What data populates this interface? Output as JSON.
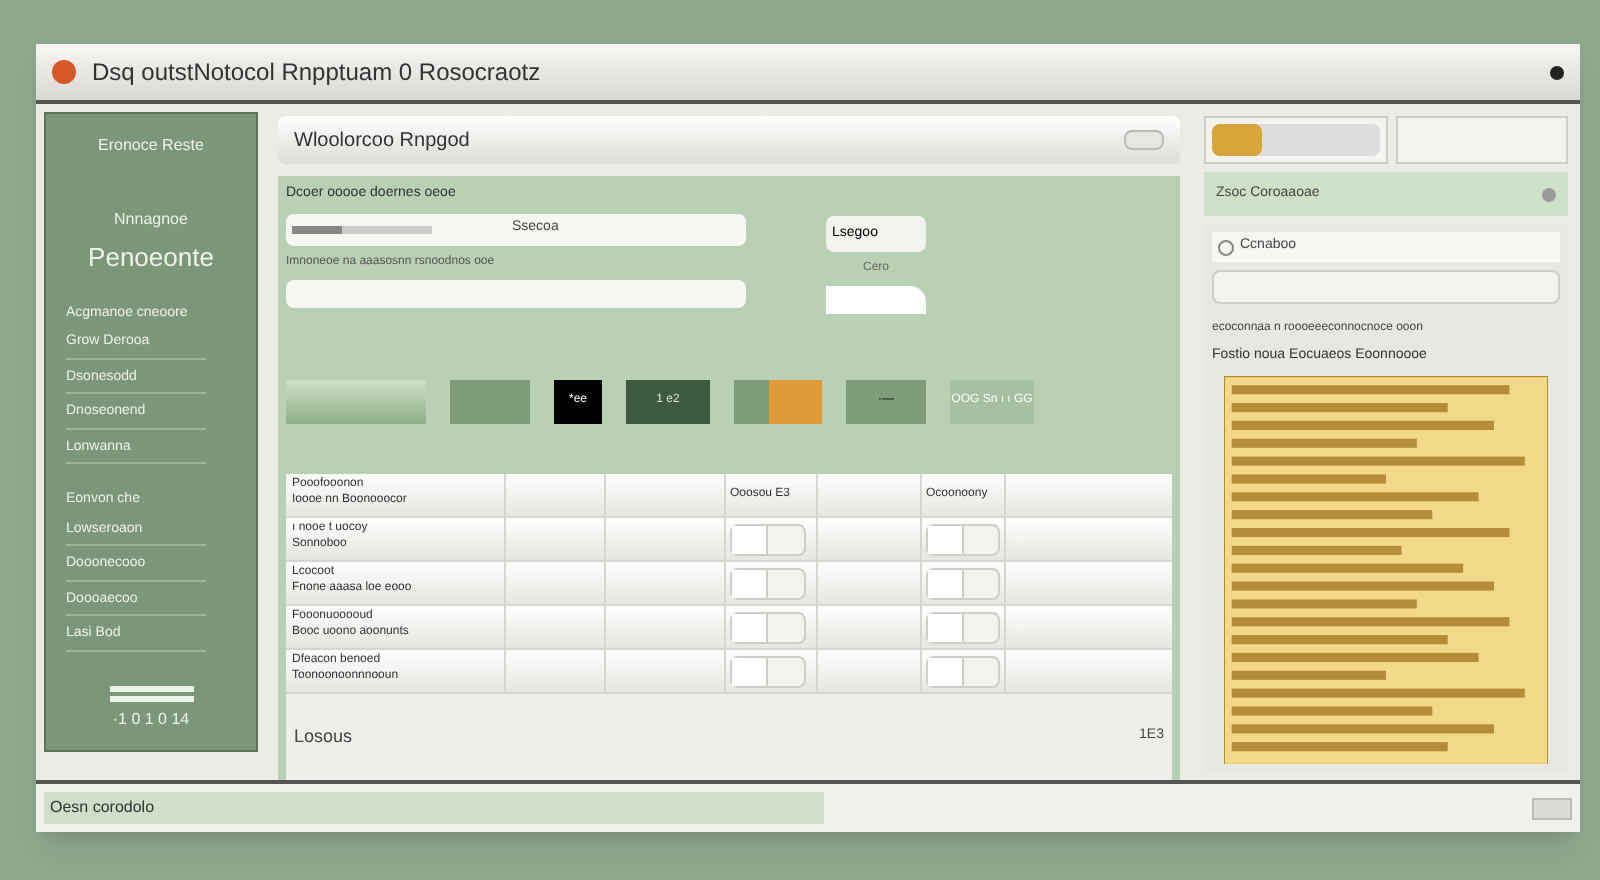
{
  "window": {
    "title": "Dsq outstNotocol Rnpptuam 0 Rosocraotz"
  },
  "sidebar": {
    "header": "Eronoce Reste",
    "subtitle": "Nnnagnoe",
    "heading": "Penoeonte",
    "sections": [
      {
        "label": "Acgmanoe cneoore",
        "items": [
          "Grow Derooa",
          "Dsonesodd",
          "Dnoseonend",
          "Lonwanna"
        ]
      },
      {
        "label": "Eonvon che",
        "items": [
          "Lowseroaon",
          "Dooonecooo",
          "Doooaecoo",
          "Lasi Bod"
        ]
      }
    ],
    "footer": "·1 0 1 0 14"
  },
  "main": {
    "title": "Wloolorcoo Rnpgod",
    "label": "Dcoer ooooe doernes oeoe",
    "field_1": {
      "value": "Ssecoa",
      "level": 0.35
    },
    "hint": "Imnoneoe na aaasosnn rsnoodnos ooe",
    "side_button": "Lsegoo",
    "side_caption": "Cero",
    "tiles": [
      {
        "kind": "plain"
      },
      {
        "kind": "green"
      },
      {
        "kind": "black",
        "text": "*ee"
      },
      {
        "kind": "dark",
        "text": "1 e2"
      },
      {
        "kind": "orange"
      },
      {
        "kind": "green",
        "text": "·—"
      },
      {
        "kind": "light",
        "text": "OOG Sn ı ı GG"
      }
    ],
    "table": {
      "rows": [
        {
          "title": "Pooofooonon",
          "detail": "Ioooe nn Boonooocor",
          "column_4": "Ooosou E3",
          "column_6": "Ocoonoony"
        },
        {
          "title": "ı nooe t uocoy",
          "detail": "Sonnoboo"
        },
        {
          "title": "Lcocoot",
          "detail": "Fnone aaasa loe eooo"
        },
        {
          "title": "Fooonuooooud",
          "detail": "Booc uoono aoonunts"
        },
        {
          "title": "Dfeacon benoed",
          "detail": "Toonoonoonnnooun"
        }
      ],
      "footer_left": "Losous",
      "footer_right": "1E3"
    }
  },
  "right": {
    "meter": {
      "level": 0.3
    },
    "panel_title": "Zsoc Coroaaoae",
    "radio": {
      "label": "Ccnaboo",
      "selected": false
    },
    "note": "ecoconnaa n roooeeeconnocnoce ooon",
    "chart_title": "Fostio noua Eocuaeos Eoonnoooe"
  },
  "status_bar": {
    "text": "Oesn corodolo",
    "level": 0.5
  }
}
